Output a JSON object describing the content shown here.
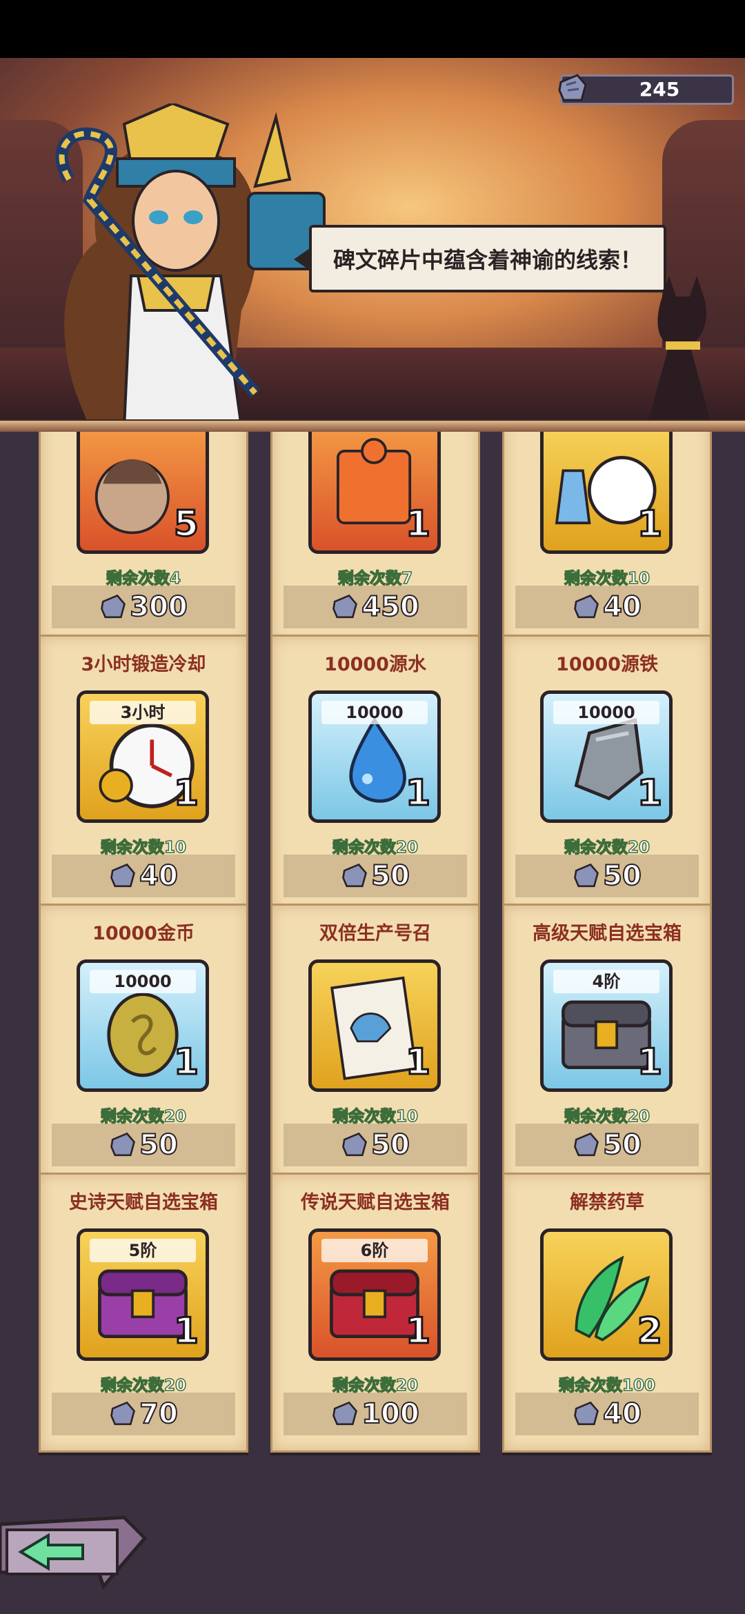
{
  "currency": {
    "value": "245",
    "icon": "rune-fragment-icon"
  },
  "banner": {
    "speech": "碑文碎片中蕴含着神谕的线索！"
  },
  "colors": {
    "title_red": "#8c2f22",
    "remaining_green": "#3c6d3a",
    "card_bg": "#f2ddb1"
  },
  "shop": {
    "cards": [
      {
        "title": "",
        "tag": "",
        "qty": "5",
        "remaining": "剩余次数4",
        "price": "300",
        "style": "orange",
        "art": "portrait"
      },
      {
        "title": "",
        "tag": "",
        "qty": "1",
        "remaining": "剩余次数7",
        "price": "450",
        "style": "orange",
        "art": "puzzle"
      },
      {
        "title": "",
        "tag": "",
        "qty": "1",
        "remaining": "剩余次数10",
        "price": "40",
        "style": "gold",
        "art": "clock-potion"
      },
      {
        "title": "3小时锻造冷却",
        "tag": "3小时",
        "qty": "1",
        "remaining": "剩余次数10",
        "price": "40",
        "style": "gold",
        "art": "clock"
      },
      {
        "title": "10000源水",
        "tag": "10000",
        "qty": "1",
        "remaining": "剩余次数20",
        "price": "50",
        "style": "blue",
        "art": "water"
      },
      {
        "title": "10000源铁",
        "tag": "10000",
        "qty": "1",
        "remaining": "剩余次数20",
        "price": "50",
        "style": "blue",
        "art": "iron"
      },
      {
        "title": "10000金币",
        "tag": "10000",
        "qty": "1",
        "remaining": "剩余次数20",
        "price": "50",
        "style": "blue",
        "art": "coin"
      },
      {
        "title": "双倍生产号召",
        "tag": "",
        "qty": "1",
        "remaining": "剩余次数10",
        "price": "50",
        "style": "gold",
        "art": "poster"
      },
      {
        "title": "高级天赋自选宝箱",
        "tag": "4阶",
        "qty": "1",
        "remaining": "剩余次数20",
        "price": "50",
        "style": "blue",
        "art": "chest-gray"
      },
      {
        "title": "史诗天赋自选宝箱",
        "tag": "5阶",
        "qty": "1",
        "remaining": "剩余次数20",
        "price": "70",
        "style": "gold",
        "art": "chest-purple"
      },
      {
        "title": "传说天赋自选宝箱",
        "tag": "6阶",
        "qty": "1",
        "remaining": "剩余次数20",
        "price": "100",
        "style": "orange",
        "art": "chest-red"
      },
      {
        "title": "解禁药草",
        "tag": "",
        "qty": "2",
        "remaining": "剩余次数100",
        "price": "40",
        "style": "gold",
        "art": "herb"
      }
    ]
  },
  "nav": {
    "back_icon": "back-arrow-icon"
  }
}
